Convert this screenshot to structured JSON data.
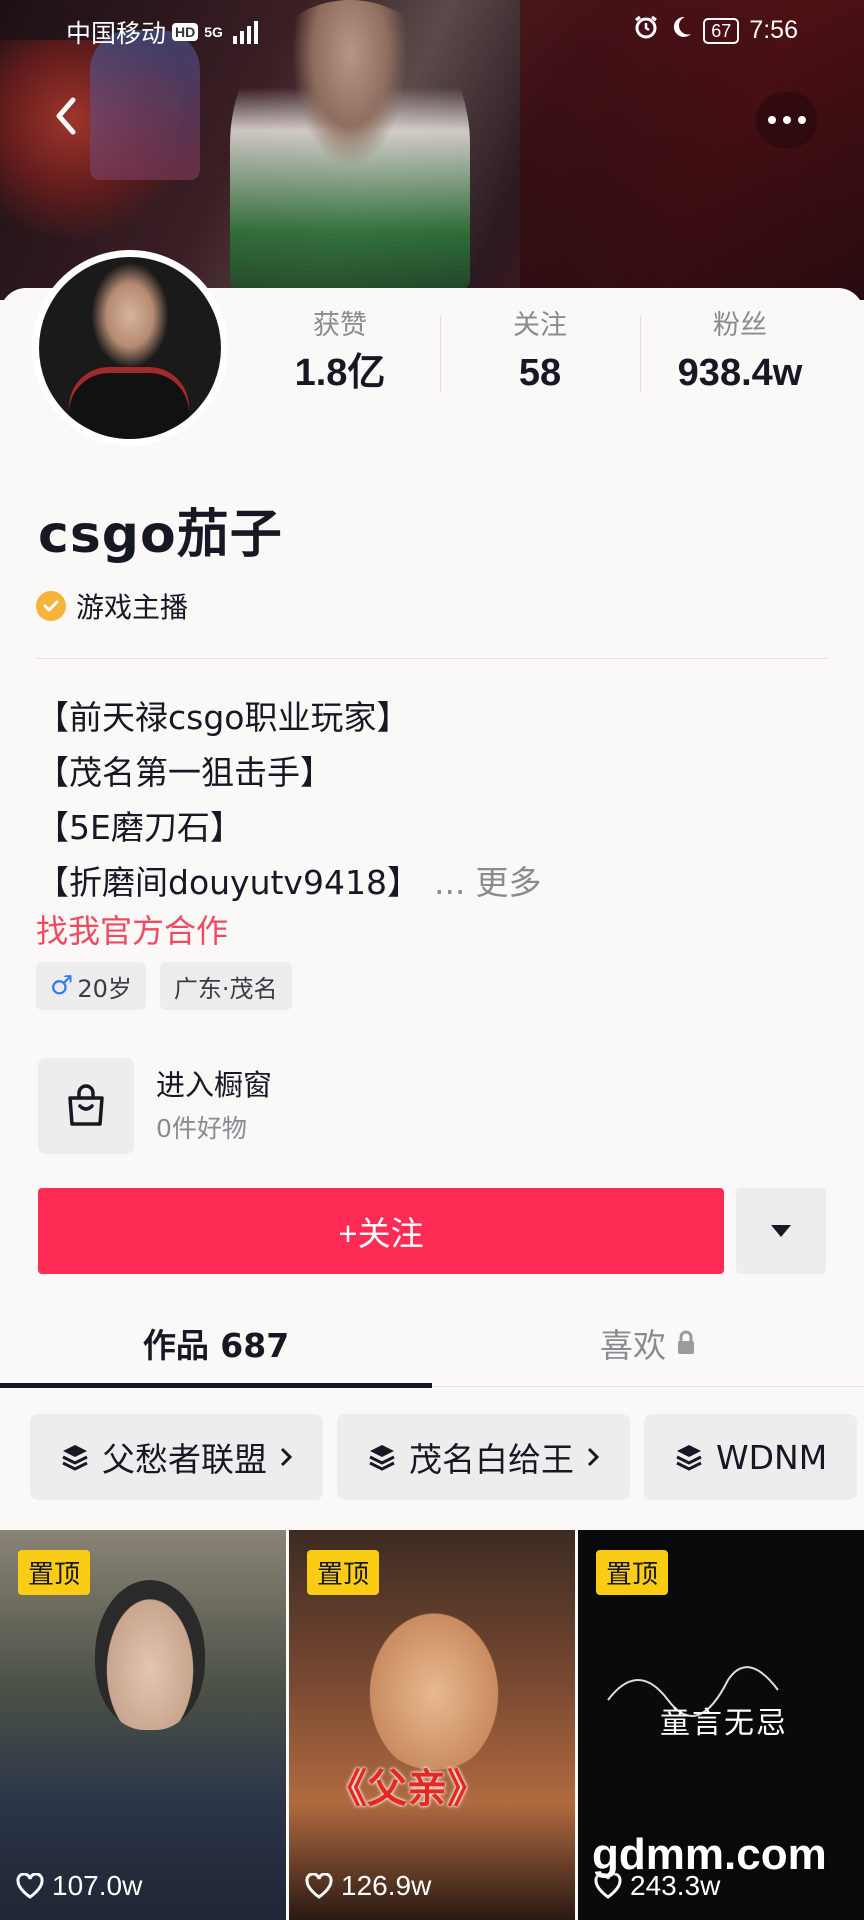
{
  "status_bar": {
    "carrier": "中国移动",
    "hd": "HD",
    "network": "5G",
    "battery": "67",
    "time": "7:56"
  },
  "profile": {
    "name": "csgo茄子",
    "verified_label": "游戏主播",
    "stats": [
      {
        "label": "获赞",
        "value": "1.8亿"
      },
      {
        "label": "关注",
        "value": "58"
      },
      {
        "label": "粉丝",
        "value": "938.4w"
      }
    ],
    "bio_lines": [
      "【前天禄csgo职业玩家】",
      "【茂名第一狙击手】",
      "【5E磨刀石】",
      "【折磨间douyutv9418】"
    ],
    "bio_ellipsis": "...",
    "bio_more": "更多",
    "cooperation_link": "找我官方合作",
    "tags": {
      "age": "20岁",
      "location": "广东·茂名"
    }
  },
  "shop": {
    "title": "进入橱窗",
    "subtitle": "0件好物"
  },
  "actions": {
    "follow_label": "+关注"
  },
  "tabs": {
    "works": "作品 687",
    "likes": "喜欢"
  },
  "collections": [
    "父愁者联盟",
    "茂名白给王",
    "WDNM"
  ],
  "videos": [
    {
      "pin": "置顶",
      "likes": "107.0w"
    },
    {
      "pin": "置顶",
      "likes": "126.9w",
      "overlay_text": "《父亲》"
    },
    {
      "pin": "置顶",
      "likes": "243.3w",
      "overlay_text": "童言无忌"
    }
  ],
  "watermark": "gdmm.com",
  "colors": {
    "accent": "#fe2c55",
    "link": "#ee4b63",
    "pin_badge": "#facc15",
    "verify_badge": "#f6b43b"
  },
  "icons": [
    "back-arrow-icon",
    "more-dots-icon",
    "verified-check-icon",
    "shopping-bag-icon",
    "caret-down-icon",
    "lock-icon",
    "collection-layers-icon",
    "chevron-right-icon",
    "heart-icon",
    "male-icon"
  ]
}
